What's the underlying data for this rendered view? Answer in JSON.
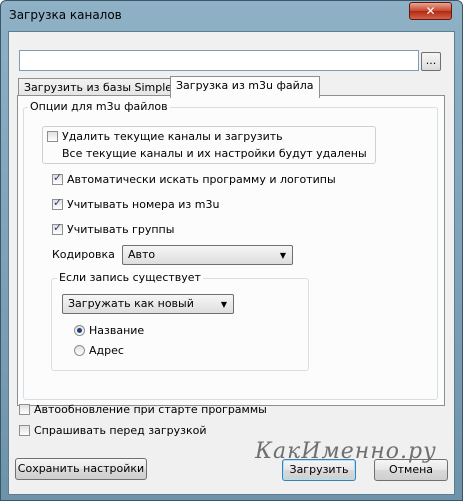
{
  "window": {
    "title": "Загрузка каналов"
  },
  "path_input": {
    "value": ""
  },
  "browse_label": "...",
  "tabs": [
    {
      "label": "Загрузить из базы SimpleTV",
      "active": false
    },
    {
      "label": "Загрузка из m3u файла",
      "active": true
    }
  ],
  "m3u_options": {
    "group_label": "Опции для m3u файлов",
    "delete_current": {
      "label": "Удалить текущие каналы  и загрузить",
      "note": "Все текущие каналы и их настройки будут удалены",
      "checked": false
    },
    "auto_search": {
      "label": "Автоматически искать программу и логотипы",
      "checked": true
    },
    "use_numbers": {
      "label": "Учитывать номера из m3u",
      "checked": true
    },
    "use_groups": {
      "label": "Учитывать группы",
      "checked": true
    },
    "encoding": {
      "label": "Кодировка",
      "value": "Авто"
    },
    "if_exists": {
      "group_label": "Если запись существует",
      "action_value": "Загружать как новый",
      "radios": [
        {
          "label": "Название",
          "checked": true
        },
        {
          "label": "Адрес",
          "checked": false
        }
      ]
    }
  },
  "auto_update": {
    "label": "Автообновление при старте программы",
    "checked": false
  },
  "ask_before": {
    "label": "Спрашивать перед загрузкой",
    "checked": false
  },
  "buttons": {
    "save": "Сохранить настройки",
    "load": "Загрузить",
    "cancel": "Отмена"
  },
  "watermark": "КакИменно.ру",
  "icons": {
    "close": "close-icon",
    "dropdown": "chevron-down-icon",
    "checkmark": "checkmark-icon"
  },
  "colors": {
    "title_bar": "#8fb1c6",
    "close_button": "#c7452c",
    "client_bg": "#f0f0f0",
    "default_button_border": "#3c7fb1"
  }
}
